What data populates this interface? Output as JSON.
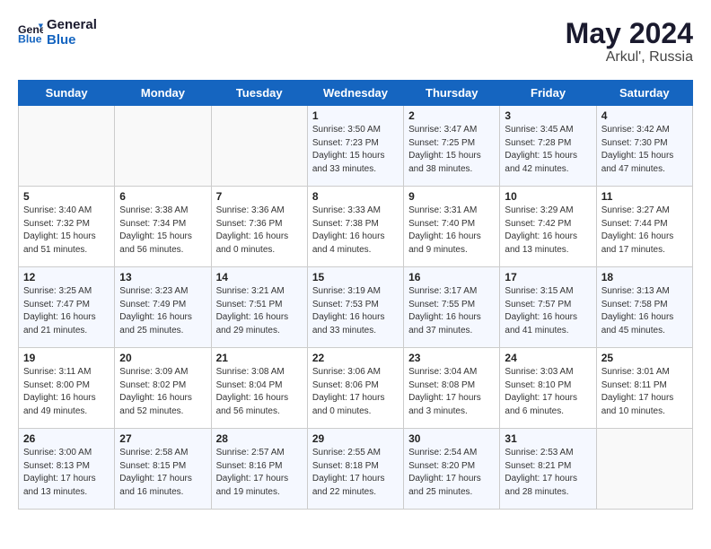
{
  "header": {
    "logo_line1": "General",
    "logo_line2": "Blue",
    "month_year": "May 2024",
    "location": "Arkul', Russia"
  },
  "days_of_week": [
    "Sunday",
    "Monday",
    "Tuesday",
    "Wednesday",
    "Thursday",
    "Friday",
    "Saturday"
  ],
  "weeks": [
    [
      {
        "day": "",
        "sunrise": "",
        "sunset": "",
        "daylight": ""
      },
      {
        "day": "",
        "sunrise": "",
        "sunset": "",
        "daylight": ""
      },
      {
        "day": "",
        "sunrise": "",
        "sunset": "",
        "daylight": ""
      },
      {
        "day": "1",
        "sunrise": "Sunrise: 3:50 AM",
        "sunset": "Sunset: 7:23 PM",
        "daylight": "Daylight: 15 hours and 33 minutes."
      },
      {
        "day": "2",
        "sunrise": "Sunrise: 3:47 AM",
        "sunset": "Sunset: 7:25 PM",
        "daylight": "Daylight: 15 hours and 38 minutes."
      },
      {
        "day": "3",
        "sunrise": "Sunrise: 3:45 AM",
        "sunset": "Sunset: 7:28 PM",
        "daylight": "Daylight: 15 hours and 42 minutes."
      },
      {
        "day": "4",
        "sunrise": "Sunrise: 3:42 AM",
        "sunset": "Sunset: 7:30 PM",
        "daylight": "Daylight: 15 hours and 47 minutes."
      }
    ],
    [
      {
        "day": "5",
        "sunrise": "Sunrise: 3:40 AM",
        "sunset": "Sunset: 7:32 PM",
        "daylight": "Daylight: 15 hours and 51 minutes."
      },
      {
        "day": "6",
        "sunrise": "Sunrise: 3:38 AM",
        "sunset": "Sunset: 7:34 PM",
        "daylight": "Daylight: 15 hours and 56 minutes."
      },
      {
        "day": "7",
        "sunrise": "Sunrise: 3:36 AM",
        "sunset": "Sunset: 7:36 PM",
        "daylight": "Daylight: 16 hours and 0 minutes."
      },
      {
        "day": "8",
        "sunrise": "Sunrise: 3:33 AM",
        "sunset": "Sunset: 7:38 PM",
        "daylight": "Daylight: 16 hours and 4 minutes."
      },
      {
        "day": "9",
        "sunrise": "Sunrise: 3:31 AM",
        "sunset": "Sunset: 7:40 PM",
        "daylight": "Daylight: 16 hours and 9 minutes."
      },
      {
        "day": "10",
        "sunrise": "Sunrise: 3:29 AM",
        "sunset": "Sunset: 7:42 PM",
        "daylight": "Daylight: 16 hours and 13 minutes."
      },
      {
        "day": "11",
        "sunrise": "Sunrise: 3:27 AM",
        "sunset": "Sunset: 7:44 PM",
        "daylight": "Daylight: 16 hours and 17 minutes."
      }
    ],
    [
      {
        "day": "12",
        "sunrise": "Sunrise: 3:25 AM",
        "sunset": "Sunset: 7:47 PM",
        "daylight": "Daylight: 16 hours and 21 minutes."
      },
      {
        "day": "13",
        "sunrise": "Sunrise: 3:23 AM",
        "sunset": "Sunset: 7:49 PM",
        "daylight": "Daylight: 16 hours and 25 minutes."
      },
      {
        "day": "14",
        "sunrise": "Sunrise: 3:21 AM",
        "sunset": "Sunset: 7:51 PM",
        "daylight": "Daylight: 16 hours and 29 minutes."
      },
      {
        "day": "15",
        "sunrise": "Sunrise: 3:19 AM",
        "sunset": "Sunset: 7:53 PM",
        "daylight": "Daylight: 16 hours and 33 minutes."
      },
      {
        "day": "16",
        "sunrise": "Sunrise: 3:17 AM",
        "sunset": "Sunset: 7:55 PM",
        "daylight": "Daylight: 16 hours and 37 minutes."
      },
      {
        "day": "17",
        "sunrise": "Sunrise: 3:15 AM",
        "sunset": "Sunset: 7:57 PM",
        "daylight": "Daylight: 16 hours and 41 minutes."
      },
      {
        "day": "18",
        "sunrise": "Sunrise: 3:13 AM",
        "sunset": "Sunset: 7:58 PM",
        "daylight": "Daylight: 16 hours and 45 minutes."
      }
    ],
    [
      {
        "day": "19",
        "sunrise": "Sunrise: 3:11 AM",
        "sunset": "Sunset: 8:00 PM",
        "daylight": "Daylight: 16 hours and 49 minutes."
      },
      {
        "day": "20",
        "sunrise": "Sunrise: 3:09 AM",
        "sunset": "Sunset: 8:02 PM",
        "daylight": "Daylight: 16 hours and 52 minutes."
      },
      {
        "day": "21",
        "sunrise": "Sunrise: 3:08 AM",
        "sunset": "Sunset: 8:04 PM",
        "daylight": "Daylight: 16 hours and 56 minutes."
      },
      {
        "day": "22",
        "sunrise": "Sunrise: 3:06 AM",
        "sunset": "Sunset: 8:06 PM",
        "daylight": "Daylight: 17 hours and 0 minutes."
      },
      {
        "day": "23",
        "sunrise": "Sunrise: 3:04 AM",
        "sunset": "Sunset: 8:08 PM",
        "daylight": "Daylight: 17 hours and 3 minutes."
      },
      {
        "day": "24",
        "sunrise": "Sunrise: 3:03 AM",
        "sunset": "Sunset: 8:10 PM",
        "daylight": "Daylight: 17 hours and 6 minutes."
      },
      {
        "day": "25",
        "sunrise": "Sunrise: 3:01 AM",
        "sunset": "Sunset: 8:11 PM",
        "daylight": "Daylight: 17 hours and 10 minutes."
      }
    ],
    [
      {
        "day": "26",
        "sunrise": "Sunrise: 3:00 AM",
        "sunset": "Sunset: 8:13 PM",
        "daylight": "Daylight: 17 hours and 13 minutes."
      },
      {
        "day": "27",
        "sunrise": "Sunrise: 2:58 AM",
        "sunset": "Sunset: 8:15 PM",
        "daylight": "Daylight: 17 hours and 16 minutes."
      },
      {
        "day": "28",
        "sunrise": "Sunrise: 2:57 AM",
        "sunset": "Sunset: 8:16 PM",
        "daylight": "Daylight: 17 hours and 19 minutes."
      },
      {
        "day": "29",
        "sunrise": "Sunrise: 2:55 AM",
        "sunset": "Sunset: 8:18 PM",
        "daylight": "Daylight: 17 hours and 22 minutes."
      },
      {
        "day": "30",
        "sunrise": "Sunrise: 2:54 AM",
        "sunset": "Sunset: 8:20 PM",
        "daylight": "Daylight: 17 hours and 25 minutes."
      },
      {
        "day": "31",
        "sunrise": "Sunrise: 2:53 AM",
        "sunset": "Sunset: 8:21 PM",
        "daylight": "Daylight: 17 hours and 28 minutes."
      },
      {
        "day": "",
        "sunrise": "",
        "sunset": "",
        "daylight": ""
      }
    ]
  ]
}
